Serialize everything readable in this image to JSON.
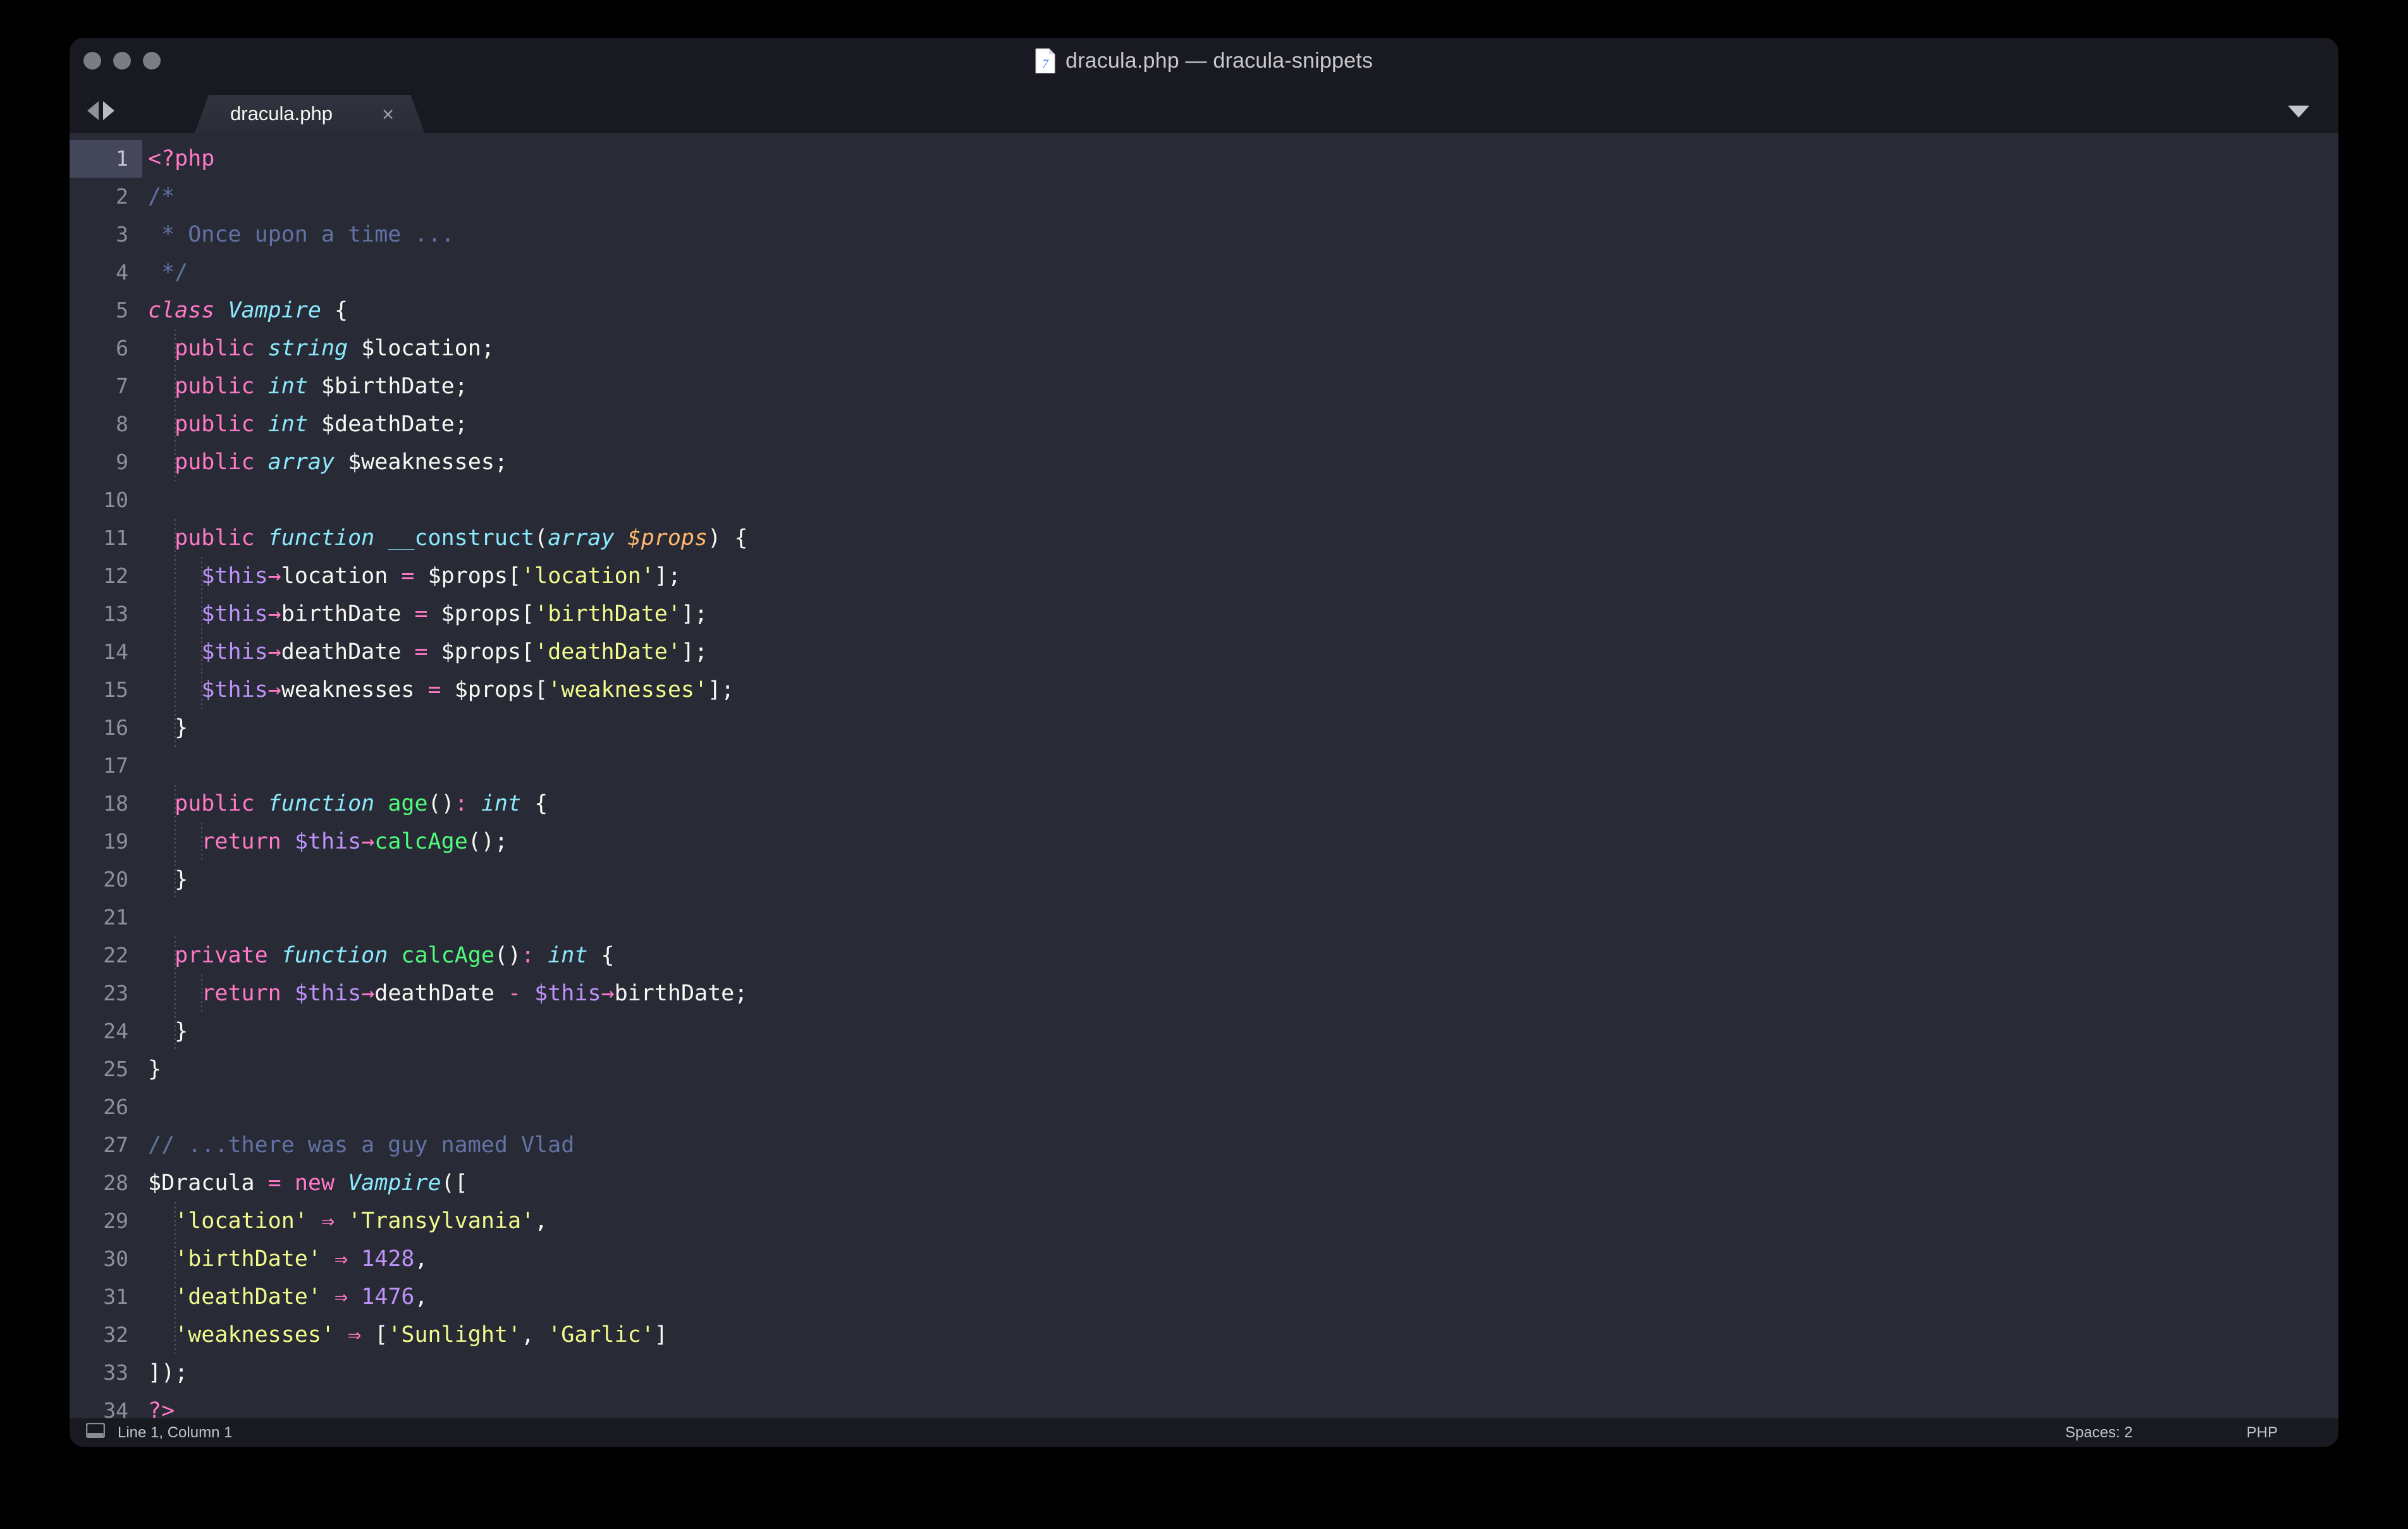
{
  "window": {
    "title": "dracula.php — dracula-snippets",
    "file_icon": "php-file-icon",
    "traffic_lights": [
      "close-button",
      "minimize-button",
      "maximize-button"
    ]
  },
  "tabbar": {
    "nav_back_icon": "arrow-left-icon",
    "nav_forward_icon": "arrow-right-icon",
    "dropdown_icon": "chevron-down-icon",
    "tabs": [
      {
        "label": "dracula.php",
        "close_label": "×",
        "active": true
      }
    ]
  },
  "editor": {
    "active_line": 1,
    "line_numbers": [
      "1",
      "2",
      "3",
      "4",
      "5",
      "6",
      "7",
      "8",
      "9",
      "10",
      "11",
      "12",
      "13",
      "14",
      "15",
      "16",
      "17",
      "18",
      "19",
      "20",
      "21",
      "22",
      "23",
      "24",
      "25",
      "26",
      "27",
      "28",
      "29",
      "30",
      "31",
      "32",
      "33",
      "34"
    ],
    "lines": [
      "<?php",
      "/*",
      " * Once upon a time ...",
      " */",
      "class Vampire {",
      "  public string $location;",
      "  public int $birthDate;",
      "  public int $deathDate;",
      "  public array $weaknesses;",
      "",
      "  public function __construct(array $props) {",
      "    $this→location = $props['location'];",
      "    $this→birthDate = $props['birthDate'];",
      "    $this→deathDate = $props['deathDate'];",
      "    $this→weaknesses = $props['weaknesses'];",
      "  }",
      "",
      "  public function age(): int {",
      "    return $this→calcAge();",
      "  }",
      "",
      "  private function calcAge(): int {",
      "    return $this→deathDate - $this→birthDate;",
      "  }",
      "}",
      "",
      "// ...there was a guy named Vlad",
      "$Dracula = new Vampire([",
      "  'location' ⇒ 'Transylvania',",
      "  'birthDate' ⇒ 1428,",
      "  'deathDate' ⇒ 1476,",
      "  'weaknesses' ⇒ ['Sunlight', 'Garlic']",
      "]);",
      "?>"
    ]
  },
  "statusbar": {
    "sidebar_toggle_icon": "sidebar-toggle-icon",
    "cursor_position": "Line 1, Column 1",
    "indentation": "Spaces: 2",
    "syntax": "PHP"
  },
  "colors": {
    "background": "#282a36",
    "chrome": "#191a21",
    "current_line": "#44475a",
    "foreground": "#f8f8f2",
    "comment": "#6272a4",
    "pink": "#ff79c6",
    "cyan": "#8be9fd",
    "green": "#50fa7b",
    "purple": "#bd93f9",
    "yellow": "#f1fa8c",
    "orange": "#ffb86c"
  }
}
